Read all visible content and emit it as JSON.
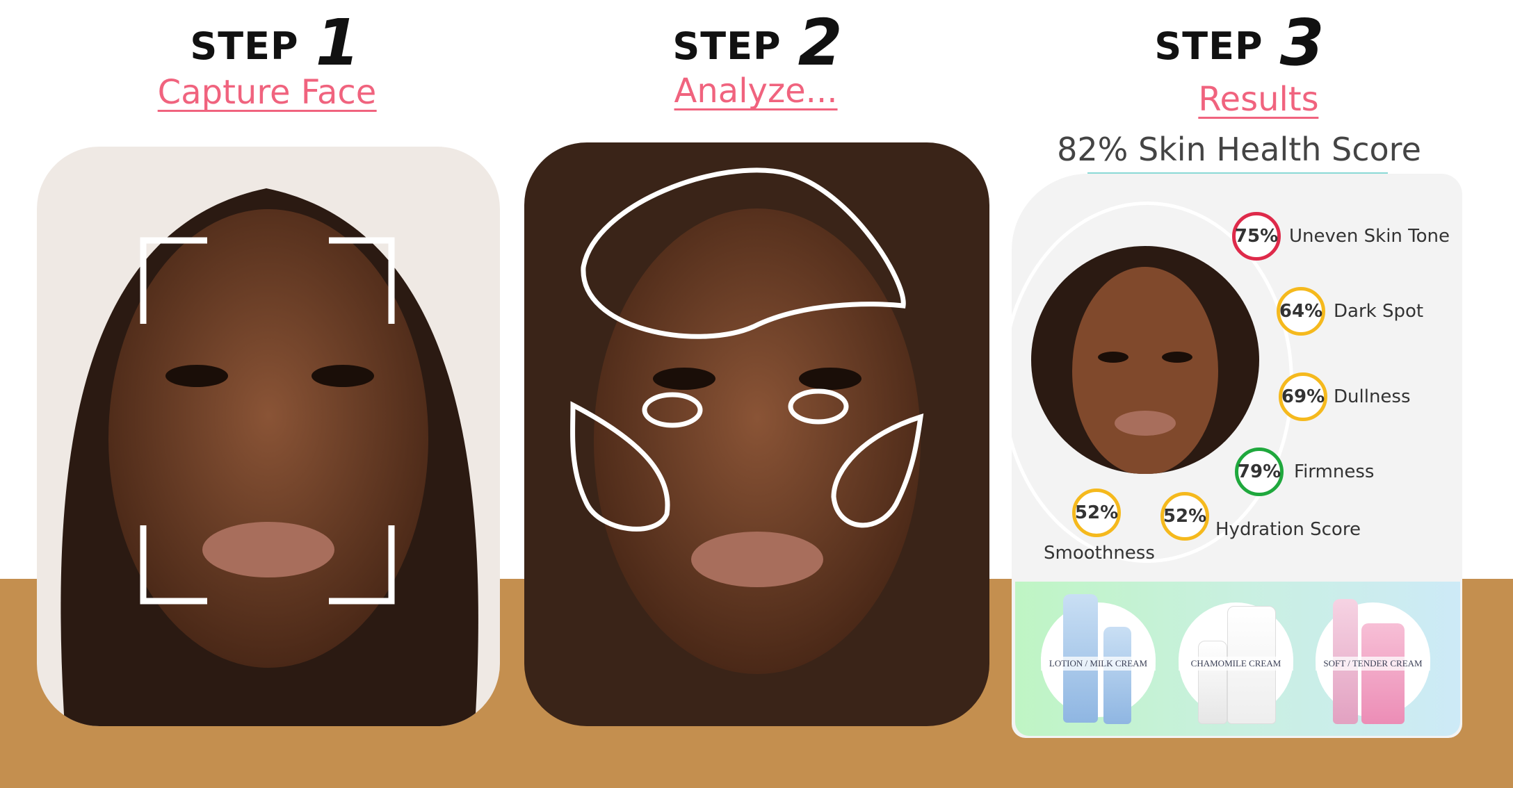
{
  "steps": [
    {
      "label": "STEP",
      "number": "1",
      "title": "Capture Face"
    },
    {
      "label": "STEP",
      "number": "2",
      "title": "Analyze..."
    },
    {
      "label": "STEP",
      "number": "3",
      "title": "Results"
    }
  ],
  "results": {
    "headline": "82% Skin Health Score",
    "metrics": [
      {
        "value": "75%",
        "label": "Uneven Skin Tone",
        "color": "#de2a4a"
      },
      {
        "value": "64%",
        "label": "Dark Spot",
        "color": "#f5b91d"
      },
      {
        "value": "69%",
        "label": "Dullness",
        "color": "#f5b91d"
      },
      {
        "value": "79%",
        "label": "Firmness",
        "color": "#1fa83d"
      },
      {
        "value": "52%",
        "label": "Hydration Score",
        "color": "#f5b91d"
      },
      {
        "value": "52%",
        "label": "Smoothness",
        "color": "#f5b91d"
      }
    ],
    "products": [
      {
        "brand_text": "LOTION / MILK CREAM"
      },
      {
        "brand_text": "CHAMOMILE CREAM"
      },
      {
        "brand_text": "SOFT / TENDER CREAM"
      }
    ]
  },
  "colors": {
    "accent": "#f0637e",
    "band": "#c48f4f",
    "underline": "#8ad9d6"
  }
}
